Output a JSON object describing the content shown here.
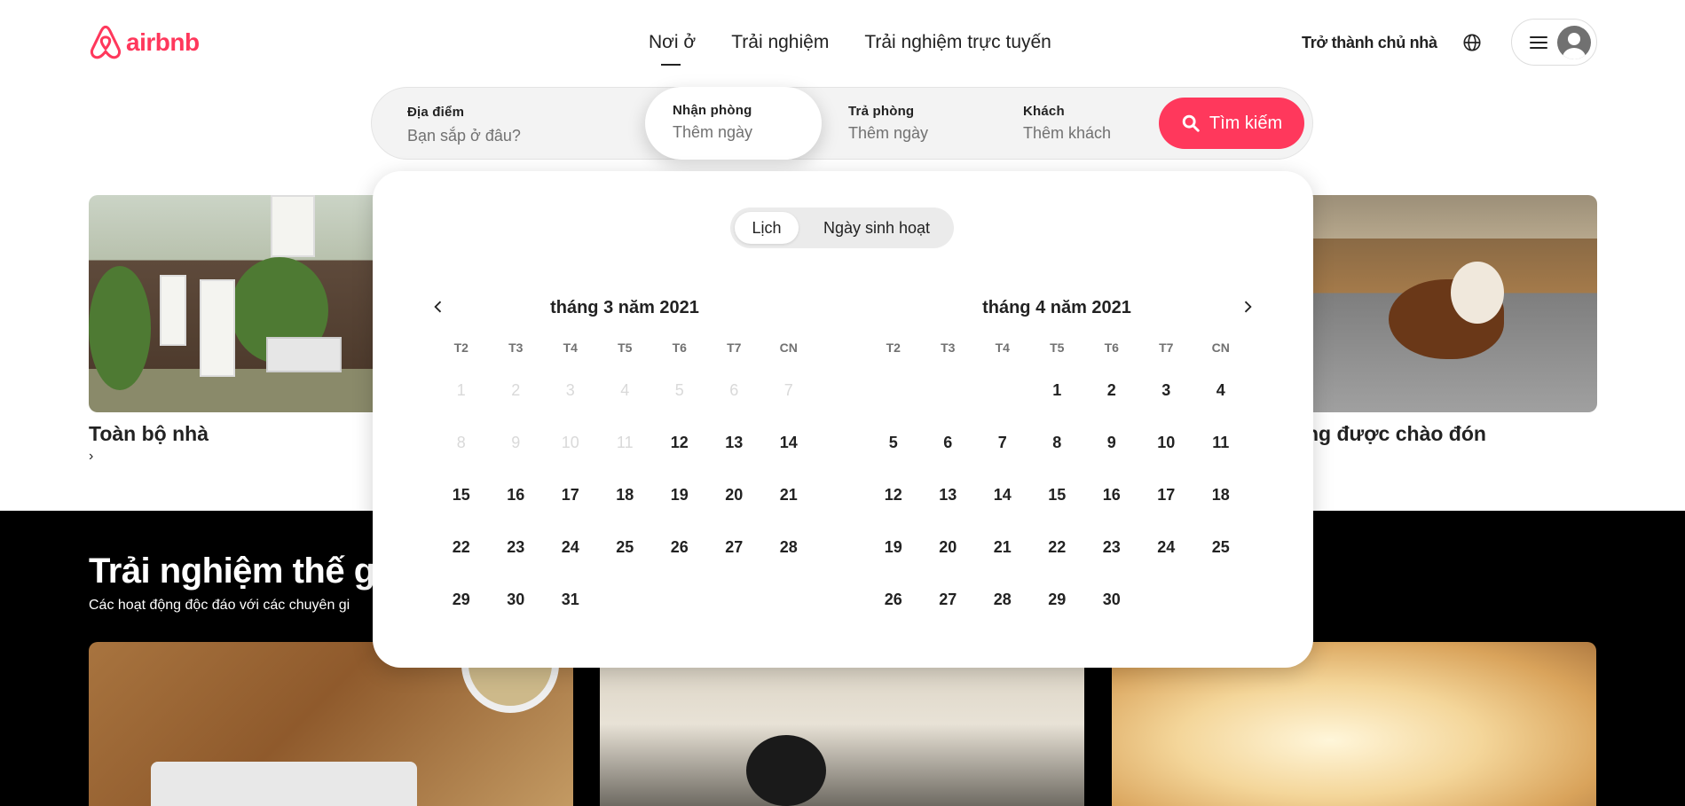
{
  "header": {
    "logo_text": "airbnb",
    "tabs": [
      {
        "label": "Nơi ở",
        "active": true
      },
      {
        "label": "Trải nghiệm",
        "active": false
      },
      {
        "label": "Trải nghiệm trực tuyến",
        "active": false
      }
    ],
    "host_link": "Trở thành chủ nhà",
    "brand_color": "#FF385C"
  },
  "search": {
    "location": {
      "label": "Địa điểm",
      "placeholder": "Bạn sắp ở đâu?"
    },
    "checkin": {
      "label": "Nhận phòng",
      "placeholder": "Thêm ngày"
    },
    "checkout": {
      "label": "Trả phòng",
      "placeholder": "Thêm ngày"
    },
    "guests": {
      "label": "Khách",
      "placeholder": "Thêm khách"
    },
    "button_label": "Tìm kiếm"
  },
  "calendar": {
    "toggle": [
      "Lịch",
      "Ngày sinh hoạt"
    ],
    "weekdays": [
      "T2",
      "T3",
      "T4",
      "T5",
      "T6",
      "T7",
      "CN"
    ],
    "months": [
      {
        "title": "tháng 3 năm 2021",
        "leading_blanks": 0,
        "days": 31,
        "past_until": 11
      },
      {
        "title": "tháng 4 năm 2021",
        "leading_blanks": 3,
        "days": 30,
        "past_until": 0
      }
    ]
  },
  "categories": [
    {
      "title": "Toàn bộ nhà",
      "sub": "›"
    },
    {
      "title": "ng được chào đón"
    }
  ],
  "experiences": {
    "title": "Trải nghiệm thế g",
    "subtitle": "Các hoạt động độc đáo với các chuyên gi"
  }
}
